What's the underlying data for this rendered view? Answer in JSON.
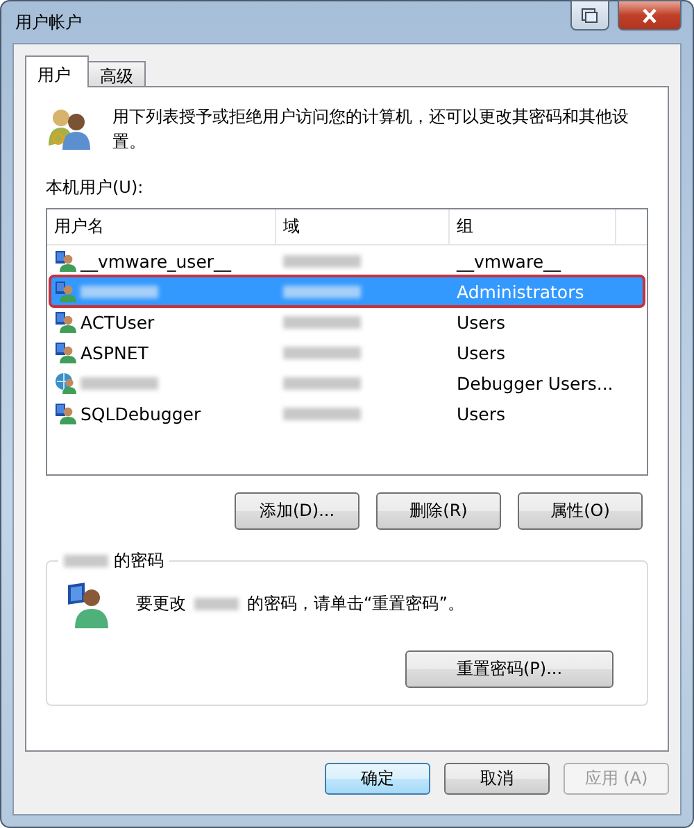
{
  "window": {
    "title": "用户帐户"
  },
  "tabs": [
    {
      "label": "用户",
      "selected": true
    },
    {
      "label": "高级",
      "selected": false
    }
  ],
  "intro": "用下列表授予或拒绝用户访问您的计算机，还可以更改其密码和其他设置。",
  "list_label": "本机用户(U):",
  "table": {
    "columns": [
      "用户名",
      "域",
      "组"
    ],
    "rows": [
      {
        "kind": "user",
        "name": "__vmware_user__",
        "name_redacted": false,
        "domain_redacted": true,
        "group": "__vmware__",
        "selected": false,
        "highlighted": false
      },
      {
        "kind": "user",
        "name_redacted": true,
        "domain_redacted": true,
        "group": "Administrators",
        "selected": true,
        "highlighted": true
      },
      {
        "kind": "user",
        "name": "ACTUser",
        "name_redacted": false,
        "domain_redacted": true,
        "group": "Users",
        "selected": false,
        "highlighted": false
      },
      {
        "kind": "user",
        "name": "ASPNET",
        "name_redacted": false,
        "domain_redacted": true,
        "group": "Users",
        "selected": false,
        "highlighted": false
      },
      {
        "kind": "network-user",
        "name_redacted": true,
        "domain_redacted": true,
        "group": "Debugger Users...",
        "selected": false,
        "highlighted": false
      },
      {
        "kind": "user",
        "name": "SQLDebugger",
        "name_redacted": false,
        "domain_redacted": true,
        "group": "Users",
        "selected": false,
        "highlighted": false
      }
    ]
  },
  "list_buttons": [
    {
      "label": "添加(D)..."
    },
    {
      "label": "删除(R)"
    },
    {
      "label": "属性(O)"
    }
  ],
  "password_group": {
    "title": "的密码",
    "title_redacted": true,
    "message_before": "要更改",
    "message_after": "的密码，请单击“重置密码”。",
    "message_redacted": true,
    "button": "重置密码(P)..."
  },
  "footer_buttons": [
    {
      "label": "确定",
      "kind": "default",
      "disabled": false
    },
    {
      "label": "取消",
      "kind": "normal",
      "disabled": false
    },
    {
      "label": "应用 (A)",
      "kind": "normal",
      "disabled": true
    }
  ]
}
